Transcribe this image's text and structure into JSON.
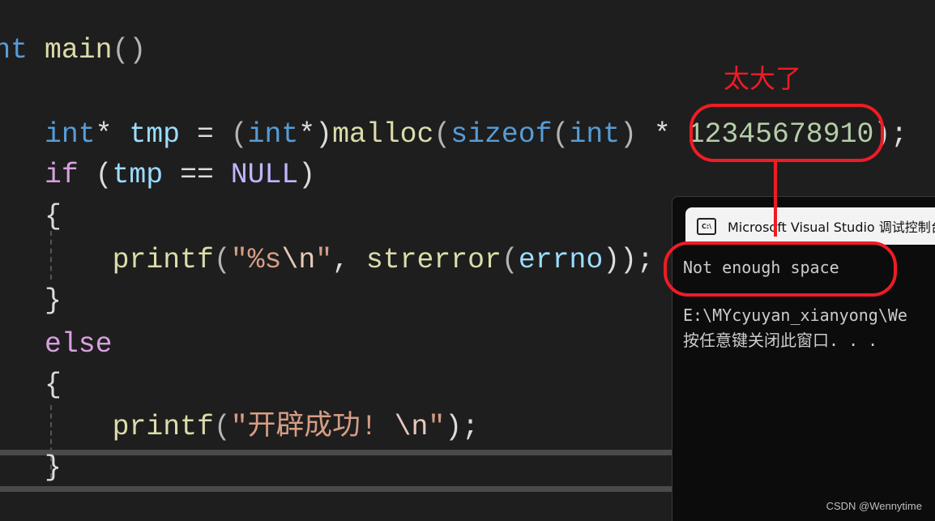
{
  "code_lines": [
    [
      [
        "int",
        "kw"
      ],
      [
        " main",
        "fn"
      ],
      [
        "()",
        "pun"
      ]
    ],
    [],
    [
      [
        "int",
        "kw"
      ],
      [
        "* ",
        ""
      ],
      [
        "tmp",
        "var"
      ],
      [
        " = ",
        ""
      ],
      [
        "(",
        "pun"
      ],
      [
        "int",
        "kw"
      ],
      [
        "*",
        ""
      ],
      [
        ")",
        ""
      ],
      [
        "malloc",
        "fn"
      ],
      [
        "(",
        "pun"
      ],
      [
        "sizeof",
        "kw"
      ],
      [
        "(",
        "pun"
      ],
      [
        "int",
        "kw"
      ],
      [
        ")",
        "pun"
      ],
      [
        " * ",
        ""
      ],
      [
        "12345678910",
        "num"
      ],
      [
        ");",
        ""
      ]
    ],
    [
      [
        "if",
        "ctl"
      ],
      [
        " (",
        ""
      ],
      [
        "tmp",
        "var"
      ],
      [
        " == ",
        ""
      ],
      [
        "NULL",
        "mac"
      ],
      [
        ")",
        ""
      ]
    ],
    [
      [
        "{",
        "brace"
      ]
    ],
    [
      [
        "printf",
        "fn"
      ],
      [
        "(",
        "pun"
      ],
      [
        "\"%s",
        "str"
      ],
      [
        "\\n",
        "esc"
      ],
      [
        "\"",
        "str"
      ],
      [
        ", ",
        ""
      ],
      [
        "strerror",
        "fn"
      ],
      [
        "(",
        "pun"
      ],
      [
        "errno",
        "var"
      ],
      [
        "));",
        ""
      ]
    ],
    [
      [
        "}",
        "brace"
      ]
    ],
    [
      [
        "else",
        "ctl"
      ]
    ],
    [
      [
        "{",
        "brace"
      ]
    ],
    [
      [
        "printf",
        "fn"
      ],
      [
        "(",
        "pun"
      ],
      [
        "\"开辟成功! ",
        "str"
      ],
      [
        "\\n",
        "esc"
      ],
      [
        "\"",
        "str"
      ],
      [
        ");",
        ""
      ]
    ],
    [
      [
        "}",
        "brace"
      ]
    ]
  ],
  "console": {
    "title": "Microsoft Visual Studio 调试控制台",
    "icon": "cmd-icon",
    "lines": [
      "Not enough space",
      "",
      "E:\\MYcyuyan_xianyong\\We",
      "按任意键关闭此窗口. . ."
    ]
  },
  "annotation": {
    "text": "太大了",
    "color": "#ee1c25"
  },
  "watermark": "CSDN @Wennytime"
}
